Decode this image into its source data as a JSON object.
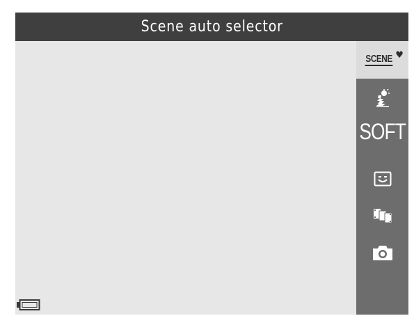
{
  "title_bar": {
    "title": "Scene auto selector"
  },
  "side_menu": {
    "items": [
      {
        "id": "scene-auto-selector",
        "icon": "scene-auto-icon",
        "label": "SCENE",
        "selected": true
      },
      {
        "id": "backlight",
        "icon": "backlight-icon",
        "selected": false
      },
      {
        "id": "soft",
        "icon": "soft-icon",
        "label": "SOFT",
        "selected": false
      },
      {
        "id": "smile-timer",
        "icon": "smile-timer-icon",
        "selected": false
      },
      {
        "id": "multi-shot",
        "icon": "multi-shot-icon",
        "selected": false
      },
      {
        "id": "camera",
        "icon": "camera-icon",
        "selected": false
      }
    ]
  },
  "status": {
    "battery_icon": "battery-icon"
  },
  "colors": {
    "title_bar": "#3f3f3f",
    "side_panel": "#6d6d6d",
    "selected_item": "#dcdcdc",
    "screen_background": "#e7e7e7"
  }
}
